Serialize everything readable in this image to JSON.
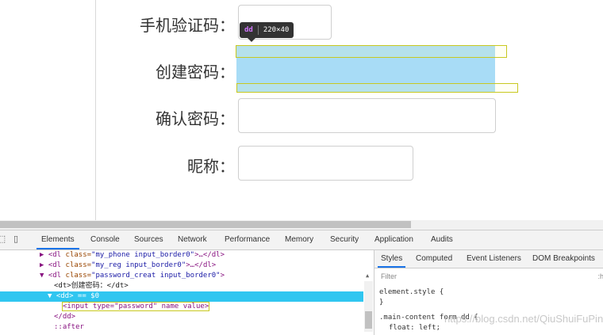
{
  "form": {
    "phone_code_label": "手机验证码：",
    "create_password_label": "创建密码：",
    "confirm_password_label": "确认密码：",
    "nickname_label": "昵称："
  },
  "tooltip": {
    "tag": "dd",
    "dims": "220×40"
  },
  "devtools": {
    "tabs": [
      "Elements",
      "Console",
      "Sources",
      "Network",
      "Performance",
      "Memory",
      "Security",
      "Application",
      "Audits"
    ],
    "elements": [
      {
        "prefix": "▶ <",
        "tag": "dl",
        "attr": " class=",
        "val": "\"my_phone input_border0\"",
        "suffix": ">…</dl>"
      },
      {
        "prefix": "▶ <",
        "tag": "dl",
        "attr": " class=",
        "val": "\"my_reg input_border0\"",
        "suffix": ">…</dl>"
      },
      {
        "prefix": "▼ <",
        "tag": "dl",
        "attr": " class=",
        "val": "\"password_creat input_border0\"",
        "suffix": ">"
      },
      {
        "text": "<dt>创建密码：</dt>"
      },
      {
        "text": "▼ <dd> == $0"
      },
      {
        "text": "<input type=\"password\" name value>"
      },
      {
        "text": "</dd>"
      },
      {
        "text": "::after"
      }
    ],
    "styles_tabs": [
      "Styles",
      "Computed",
      "Event Listeners",
      "DOM Breakpoints"
    ],
    "filter_placeholder": "Filter",
    "filter_right": ":h",
    "styles_lines": [
      "element.style {",
      "}",
      ".main-content form dd {",
      "float: left;"
    ]
  },
  "watermark": "https://blog.csdn.net/QiuShuiFuPing",
  "colors": {
    "selection": "#30c6f0",
    "highlight": "#a8dcf6",
    "active_tab": "#1a73e8"
  }
}
